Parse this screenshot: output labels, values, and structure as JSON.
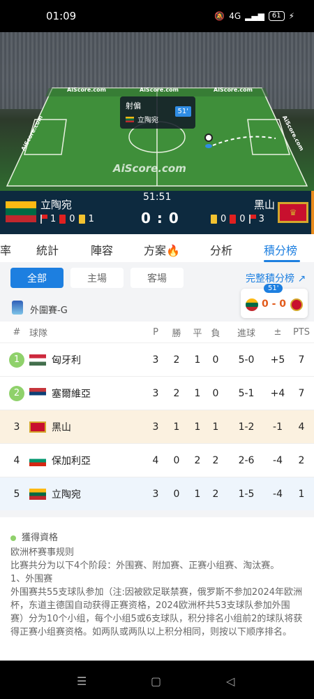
{
  "status_bar": {
    "time": "01:09",
    "network": "4G",
    "battery": "61"
  },
  "field": {
    "ads": [
      "AiScore.com",
      "AiScore.com",
      "AiScore.com",
      "AiScore.com",
      "AiScore.com"
    ],
    "watermark": "AiScore.com",
    "event": {
      "title": "射偏",
      "team": "立陶宛",
      "minute": "51'"
    }
  },
  "scoreboard": {
    "clock": "51:51",
    "score": "0 : 0",
    "home": {
      "name": "立陶宛",
      "corners": "1",
      "red_cards": "0",
      "yellow_cards": "1"
    },
    "away": {
      "name": "黑山",
      "yellow_cards": "0",
      "red_cards": "0",
      "corners": "3"
    }
  },
  "tabs": [
    "率",
    "統計",
    "陣容",
    "方案",
    "分析",
    "積分榜"
  ],
  "active_tab": "積分榜",
  "filters": {
    "all": "全部",
    "home": "主場",
    "away": "客場"
  },
  "full_table_link": "完整積分榜",
  "mini_score": {
    "minute": "51'",
    "score": "0 - 0"
  },
  "group_label": "外圍賽-G",
  "table": {
    "headers": {
      "rank": "#",
      "team": "球隊",
      "p": "P",
      "w": "勝",
      "d": "平",
      "l": "負",
      "goals": "進球",
      "gd": "±",
      "pts": "PTS"
    },
    "rows": [
      {
        "rank": "1",
        "team": "匈牙利",
        "p": "3",
        "w": "2",
        "d": "1",
        "l": "0",
        "goals": "5-0",
        "gd": "+5",
        "pts": "7"
      },
      {
        "rank": "2",
        "team": "塞爾維亞",
        "p": "3",
        "w": "2",
        "d": "1",
        "l": "0",
        "goals": "5-1",
        "gd": "+4",
        "pts": "7"
      },
      {
        "rank": "3",
        "team": "黑山",
        "p": "3",
        "w": "1",
        "d": "1",
        "l": "1",
        "goals": "1-2",
        "gd": "-1",
        "pts": "4"
      },
      {
        "rank": "4",
        "team": "保加利亞",
        "p": "4",
        "w": "0",
        "d": "2",
        "l": "2",
        "goals": "2-6",
        "gd": "-4",
        "pts": "2"
      },
      {
        "rank": "5",
        "team": "立陶宛",
        "p": "3",
        "w": "0",
        "d": "1",
        "l": "2",
        "goals": "1-5",
        "gd": "-4",
        "pts": "1"
      }
    ]
  },
  "rules": {
    "qualification": "獲得資格",
    "lines": [
      "欧洲杯赛事规则",
      "比赛共分为以下4个阶段：外围赛、附加赛、正赛小组赛、淘汰赛。",
      "1、外围赛",
      "外围赛共55支球队参加（注:因被欧足联禁赛，俄罗斯不参加2024年欧洲杯，东道主德国自动获得正赛资格，2024欧洲杯共53支球队参加外围赛）分为10个小组，每个小组5或6支球队，积分排名小组前2的球队将获得正赛小组赛资格。如两队或两队以上积分相同，则按以下顺序排名。"
    ]
  },
  "colors": {
    "accent": "#1d7fe0",
    "qualified": "#8fd16b",
    "scoreboard_bg": "#0d2a3f"
  }
}
